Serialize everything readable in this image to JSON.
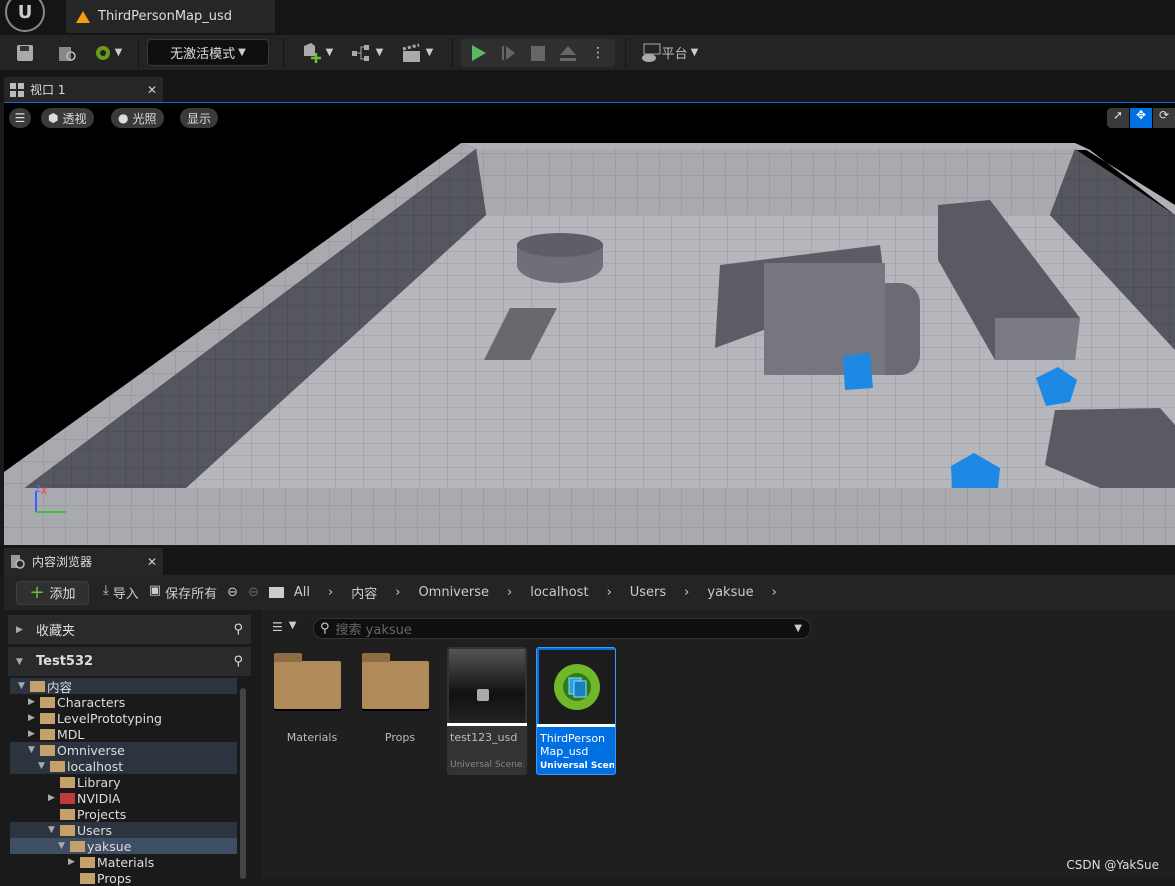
{
  "window": {
    "doc_tab": "ThirdPersonMap_usd"
  },
  "toolbar": {
    "mode": "无激活模式",
    "platform": "平台"
  },
  "viewport": {
    "tab": "视口 1",
    "perspective": "透视",
    "lighting": "光照",
    "show": "显示",
    "axis_x": "X",
    "axis_z": "Z"
  },
  "content_browser": {
    "tab": "内容浏览器",
    "add": "添加",
    "import": "导入",
    "save_all": "保存所有",
    "breadcrumb": [
      "All",
      "内容",
      "Omniverse",
      "localhost",
      "Users",
      "yaksue"
    ],
    "favorites": "收藏夹",
    "project": "Test532",
    "search_placeholder": "搜索 yaksue",
    "tree": [
      {
        "label": "内容",
        "depth": 0,
        "open": true,
        "hl": true
      },
      {
        "label": "Characters",
        "depth": 1,
        "closed": true
      },
      {
        "label": "LevelPrototyping",
        "depth": 1,
        "closed": true
      },
      {
        "label": "MDL",
        "depth": 1,
        "closed": true
      },
      {
        "label": "Omniverse",
        "depth": 1,
        "open": true,
        "hl": true
      },
      {
        "label": "localhost",
        "depth": 2,
        "open": true,
        "hl": true
      },
      {
        "label": "Library",
        "depth": 3
      },
      {
        "label": "NVIDIA",
        "depth": 3,
        "closed": true,
        "red": true
      },
      {
        "label": "Projects",
        "depth": 3
      },
      {
        "label": "Users",
        "depth": 3,
        "open": true,
        "hl": true
      },
      {
        "label": "yaksue",
        "depth": 4,
        "open": true,
        "sel": true
      },
      {
        "label": "Materials",
        "depth": 5,
        "closed": true
      },
      {
        "label": "Props",
        "depth": 5
      }
    ],
    "items": [
      {
        "name": "Materials",
        "kind": "folder"
      },
      {
        "name": "Props",
        "kind": "folder"
      },
      {
        "name": "test123_usd",
        "kind": "asset",
        "type": "Universal Scene..."
      },
      {
        "name": "ThirdPerson Map_usd",
        "kind": "asset",
        "type": "Universal Scene...",
        "selected": true
      }
    ]
  },
  "watermark": "CSDN @YakSue",
  "colors": {
    "accent": "#0070e0",
    "play": "#5cb85c",
    "cube": "#1e88e5",
    "folder": "#c4a06a"
  }
}
